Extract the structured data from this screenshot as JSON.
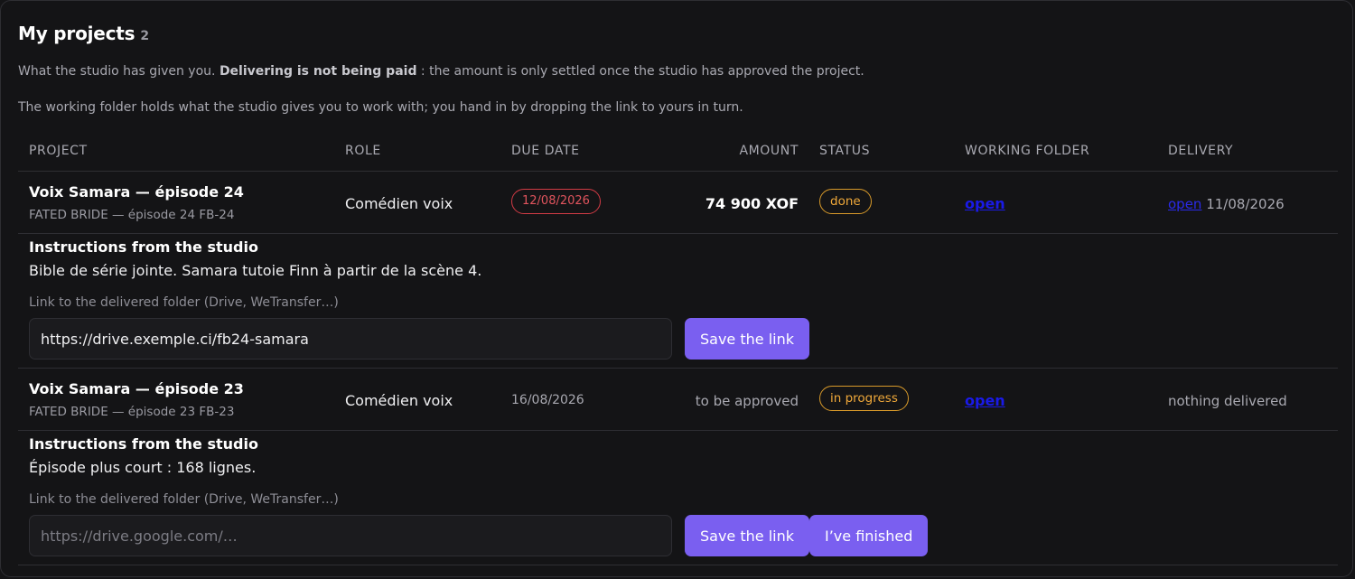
{
  "header": {
    "title": "My projects",
    "count": "2",
    "intro_prefix": "What the studio has given you. ",
    "intro_bold": "Delivering is not being paid",
    "intro_suffix": " : the amount is only settled once the studio has approved the project.",
    "intro_line2": "The working folder holds what the studio gives you to work with; you hand in by dropping the link to yours in turn."
  },
  "columns": [
    "Project",
    "Role",
    "Due date",
    "Amount",
    "Status",
    "Working folder",
    "Delivery"
  ],
  "projects": [
    {
      "name": "Voix Samara — épisode 24",
      "subtitle": "FATED BRIDE — épisode 24 FB-24",
      "role": "Comédien voix",
      "due_date": "12/08/2026",
      "amount": "74 900 XOF",
      "status": "done",
      "folder_link": "open",
      "delivery_link": "open",
      "delivery_date": "11/08/2026",
      "instructions_title": "Instructions from the studio",
      "instructions": "Bible de série jointe. Samara tutoie Finn à partir de la scène 4.",
      "link_label": "Link to the delivered folder (Drive, WeTransfer…)",
      "link_value": "https://drive.exemple.ci/fb24-samara",
      "save_label": "Save the link"
    },
    {
      "name": "Voix Samara — épisode 23",
      "subtitle": "FATED BRIDE — épisode 23 FB-23",
      "role": "Comédien voix",
      "due_date": "16/08/2026",
      "amount": "to be approved",
      "status": "in progress",
      "folder_link": "open",
      "delivery_text": "nothing delivered",
      "instructions_title": "Instructions from the studio",
      "instructions": "Épisode plus court : 168 lignes.",
      "link_label": "Link to the delivered folder (Drive, WeTransfer…)",
      "link_placeholder": "https://drive.google.com/…",
      "save_label": "Save the link",
      "finish_label": "I’ve finished"
    }
  ],
  "colors": {
    "accent": "#7a5ff0",
    "overdue": "#d23b45",
    "status": "#d89a2a",
    "link": "#1a1ae8"
  }
}
